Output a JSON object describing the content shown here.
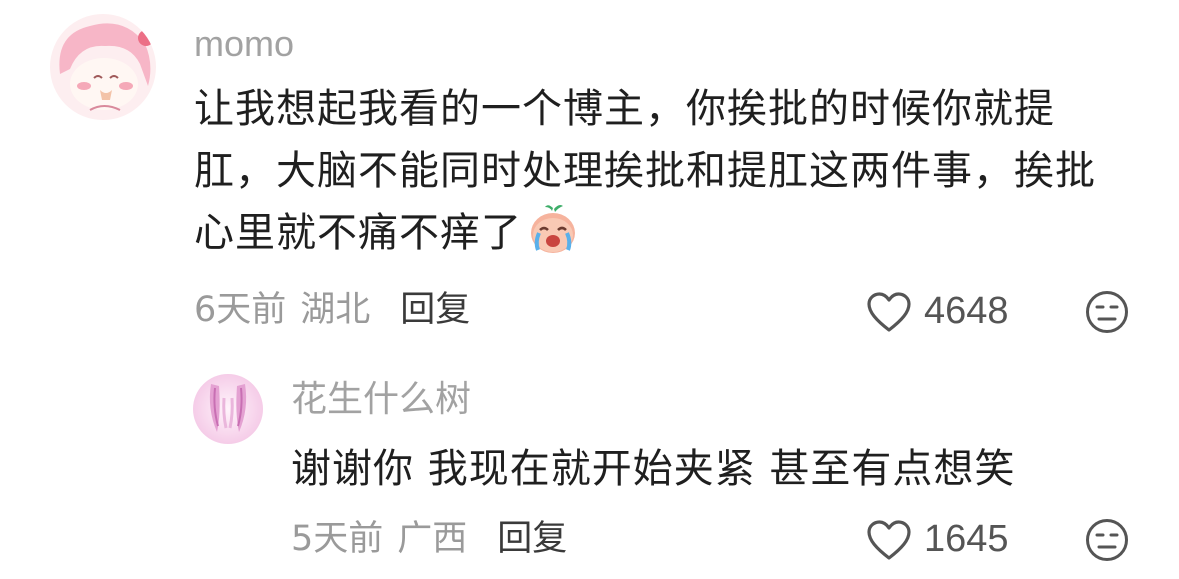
{
  "comments": [
    {
      "username": "momo",
      "text": "让我想起我看的一个博主，你挨批的时候你就提肛，大脑不能同时处理挨批和提肛这两件事，挨批心里就不痛不痒了",
      "emoji_icon": "crying-laughing-peach-emoji",
      "time": "6天前",
      "location": "湖北",
      "reply_label": "回复",
      "likes": "4648"
    },
    {
      "username": "花生什么树",
      "text": "谢谢你 我现在就开始夹紧 甚至有点想笑",
      "time": "5天前",
      "location": "广西",
      "reply_label": "回复",
      "likes": "1645"
    }
  ],
  "colors": {
    "username": "#a2a2a2",
    "body_text": "#1f1f1f",
    "meta_text": "#9a9a9a",
    "reply_text": "#3a3a3a",
    "icon_stroke": "#555555"
  }
}
